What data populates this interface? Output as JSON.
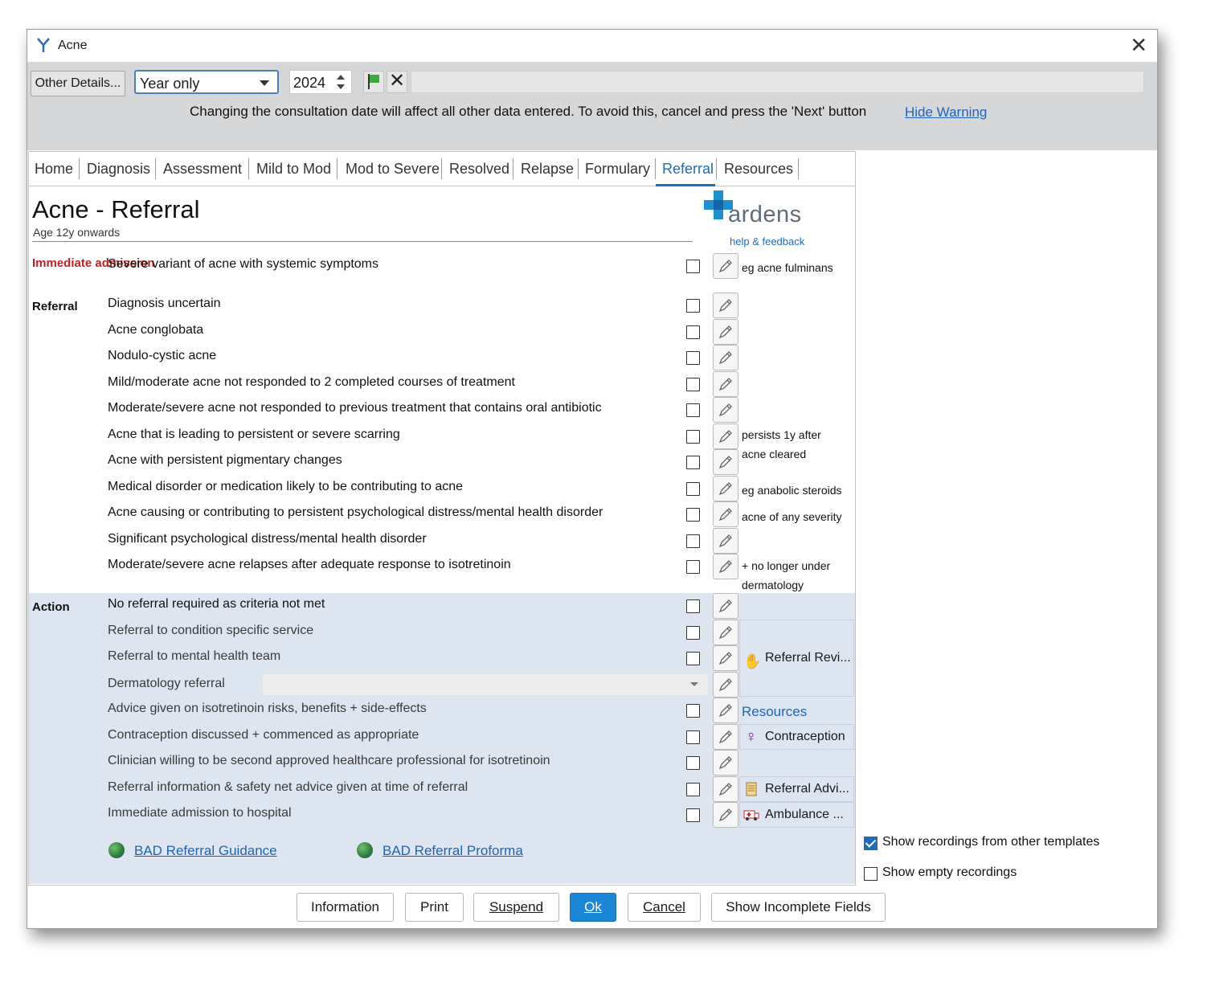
{
  "window": {
    "title": "Acne"
  },
  "toolbar": {
    "other_details_label": "Other Details...",
    "date_mode": "Year only",
    "year": "2024",
    "warning_text": "Changing the consultation date will affect all other data entered. To avoid this, cancel and press the 'Next' button",
    "hide_warning_label": "Hide Warning"
  },
  "tabs": [
    "Home",
    "Diagnosis",
    "Assessment",
    "Mild to Mod",
    "Mod to Severe",
    "Resolved",
    "Relapse",
    "Formulary",
    "Referral",
    "Resources"
  ],
  "active_tab": "Referral",
  "page": {
    "title": "Acne - Referral",
    "subtitle": "Age 12y onwards",
    "brand": "ardens",
    "brand_link": "help & feedback"
  },
  "sections": {
    "immediate_admission": "Immediate admission",
    "referral": "Referral",
    "action": "Action"
  },
  "immediate_rows": [
    {
      "label": "Severe variant of acne with systemic symptoms",
      "note": "eg acne fulminans"
    }
  ],
  "referral_rows": [
    {
      "label": "Diagnosis uncertain"
    },
    {
      "label": "Acne conglobata"
    },
    {
      "label": "Nodulo-cystic acne"
    },
    {
      "label": "Mild/moderate acne not responded to 2 completed courses of treatment"
    },
    {
      "label": "Moderate/severe acne not responded to previous treatment that contains oral antibiotic"
    },
    {
      "label": "Acne that is leading to persistent or severe scarring"
    },
    {
      "label": "Acne with persistent pigmentary changes"
    },
    {
      "label": "Medical disorder or medication likely to be contributing to acne"
    },
    {
      "label": "Acne causing or contributing to persistent psychological distress/mental health disorder"
    },
    {
      "label": "Significant psychological distress/mental health disorder"
    },
    {
      "label": "Moderate/severe acne relapses after adequate response to isotretinoin"
    }
  ],
  "referral_notes": {
    "scarring_line1": "persists 1y after",
    "scarring_line2": "acne cleared",
    "medical": "eg anabolic steroids",
    "psych": "acne of any severity",
    "relapse_line1": "+ no longer under",
    "relapse_line2": "dermatology"
  },
  "action_rows": [
    {
      "label": "No referral required as criteria not met"
    },
    {
      "label": "Referral to condition specific service"
    },
    {
      "label": "Referral to mental health team"
    },
    {
      "label": "Dermatology referral"
    },
    {
      "label": "Advice given on isotretinoin risks, benefits + side-effects"
    },
    {
      "label": "Contraception discussed + commenced as appropriate"
    },
    {
      "label": "Clinician willing to be second approved healthcare professional for isotretinoin"
    },
    {
      "label": "Referral information & safety net advice given at time of referral"
    },
    {
      "label": "Immediate admission to hospital"
    }
  ],
  "action_side": {
    "referral_review": "Referral Revi...",
    "resources": "Resources",
    "contraception": "Contraception",
    "referral_advice": "Referral Advi...",
    "ambulance": "Ambulance ..."
  },
  "links": {
    "bad_guidance": "BAD Referral Guidance",
    "bad_proforma": "BAD Referral Proforma"
  },
  "options": {
    "show_other_templates": "Show recordings from other templates",
    "show_other_templates_checked": true,
    "show_empty": "Show empty recordings",
    "show_empty_checked": false
  },
  "footer": {
    "information": "Information",
    "print": "Print",
    "suspend": "Suspend",
    "ok": "Ok",
    "cancel": "Cancel",
    "show_incomplete": "Show Incomplete Fields"
  },
  "icons": [
    "app-logo-icon",
    "close-icon",
    "flag-icon",
    "clear-date-icon",
    "edit-pencil-icon",
    "hand-icon",
    "female-symbol-icon",
    "document-icon",
    "ambulance-icon",
    "globe-icon"
  ],
  "colors": {
    "accent": "#1f6ab9",
    "action_bg": "#dce5f0",
    "warning_red": "#c41f1f",
    "primary_button": "#1c87d6"
  }
}
